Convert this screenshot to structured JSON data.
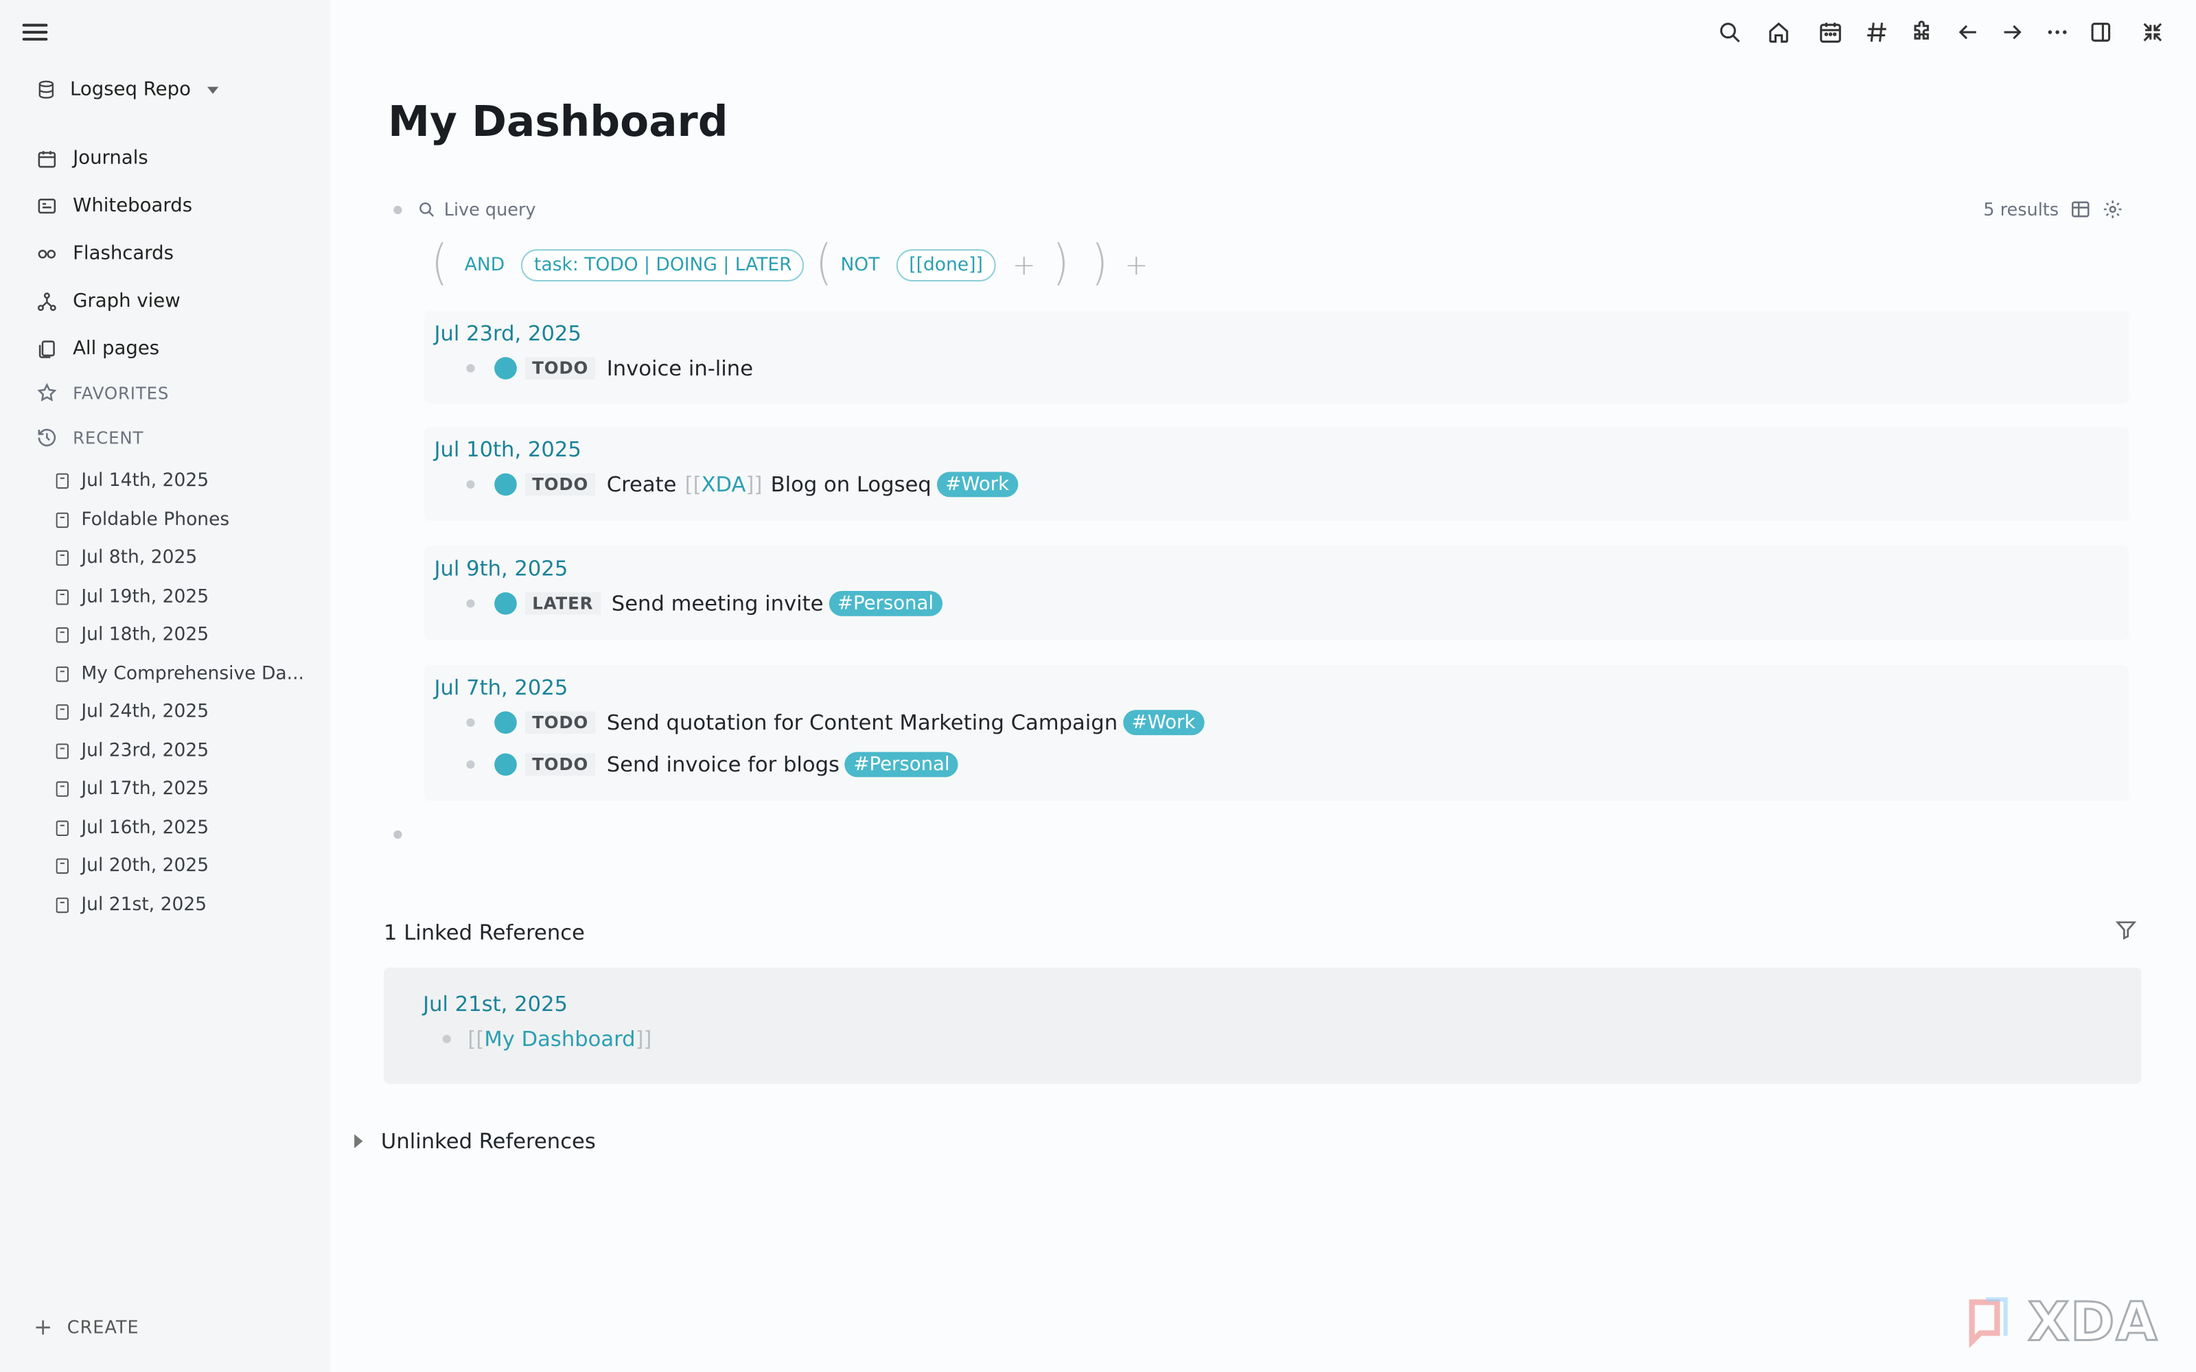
{
  "sidebar": {
    "repo_name": "Logseq Repo",
    "nav": [
      {
        "label": "Journals",
        "icon": "calendar-icon"
      },
      {
        "label": "Whiteboards",
        "icon": "whiteboard-icon"
      },
      {
        "label": "Flashcards",
        "icon": "infinity-icon"
      },
      {
        "label": "Graph view",
        "icon": "graph-icon"
      },
      {
        "label": "All pages",
        "icon": "pages-icon"
      }
    ],
    "favorites_label": "FAVORITES",
    "recent_label": "RECENT",
    "recent": [
      "Jul 14th, 2025",
      "Foldable Phones",
      "Jul 8th, 2025",
      "Jul 19th, 2025",
      "Jul 18th, 2025",
      "My Comprehensive Da...",
      "Jul 24th, 2025",
      "Jul 23rd, 2025",
      "Jul 17th, 2025",
      "Jul 16th, 2025",
      "Jul 20th, 2025",
      "Jul 21st, 2025"
    ],
    "create_label": "CREATE"
  },
  "page": {
    "title": "My Dashboard"
  },
  "query": {
    "label": "Live query",
    "results": "5 results",
    "builder": {
      "and": "AND",
      "task_filter": "task: TODO | DOING | LATER",
      "not": "NOT",
      "done_ref": "[[done]]"
    },
    "groups": [
      {
        "date": "Jul 23rd, 2025",
        "tasks": [
          {
            "marker": "TODO",
            "text": "Invoice in-line",
            "tag": ""
          }
        ]
      },
      {
        "date": "Jul 10th, 2025",
        "tasks": [
          {
            "marker": "TODO",
            "pre": "Create",
            "ref": "XDA",
            "post": "Blog on Logseq",
            "tag": "#Work"
          }
        ]
      },
      {
        "date": "Jul 9th, 2025",
        "tasks": [
          {
            "marker": "LATER",
            "text": "Send meeting invite",
            "tag": "#Personal"
          }
        ]
      },
      {
        "date": "Jul 7th, 2025",
        "tasks": [
          {
            "marker": "TODO",
            "text": "Send quotation for Content Marketing Campaign",
            "tag": "#Work"
          },
          {
            "marker": "TODO",
            "text": "Send invoice for blogs",
            "tag": "#Personal"
          }
        ]
      }
    ]
  },
  "references": {
    "linked_title": "1 Linked Reference",
    "linked_date": "Jul 21st, 2025",
    "linked_ref": "My Dashboard",
    "unlinked_title": "Unlinked References"
  },
  "brand": {
    "watermark": "XDA"
  },
  "colors": {
    "accent": "#2a9fb2",
    "tag_bg": "#4ab9cb",
    "check": "#3eb1c5"
  }
}
